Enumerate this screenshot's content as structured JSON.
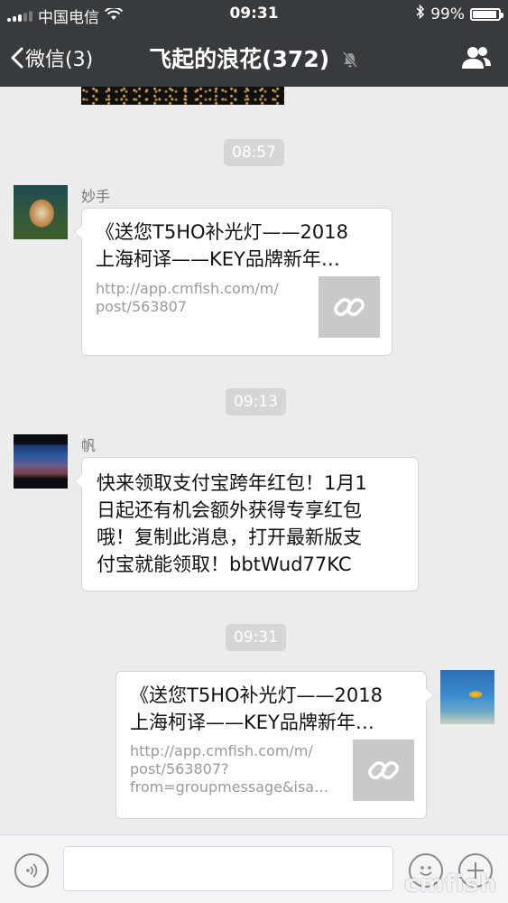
{
  "status_bar": {
    "carrier": "中国电信",
    "time": "09:31",
    "battery_percent": "99%",
    "battery_level": 0.99
  },
  "nav": {
    "back_label": "微信(3)",
    "title": "飞起的浪花(372)",
    "icons": [
      "chevron-left-icon",
      "mute-icon",
      "contacts-icon"
    ]
  },
  "messages": [
    {
      "type": "timestamp",
      "text": "08:57"
    },
    {
      "type": "link",
      "side": "left",
      "sender": "妙手",
      "title_lines": [
        "《送您T5HO补光灯——2018",
        "上海柯译——KEY品牌新年…"
      ],
      "url_lines": [
        "http://app.cmfish.com/m/",
        "post/563807"
      ]
    },
    {
      "type": "timestamp",
      "text": "09:13"
    },
    {
      "type": "text",
      "side": "left",
      "sender": "帆",
      "lines": [
        "快来领取支付宝跨年红包！1月1",
        "日起还有机会额外获得专享红包",
        "哦！复制此消息，打开最新版支",
        "付宝就能领取！bbtWud77KC"
      ]
    },
    {
      "type": "timestamp",
      "text": "09:31"
    },
    {
      "type": "link",
      "side": "right",
      "title_lines": [
        "《送您T5HO补光灯——2018",
        "上海柯译——KEY品牌新年…"
      ],
      "url_lines": [
        "http://app.cmfish.com/m/",
        "post/563807?",
        "from=groupmessage&isa…"
      ]
    }
  ],
  "input_bar": {
    "icons": [
      "voice-icon",
      "emoji-icon",
      "plus-icon"
    ]
  },
  "watermark": "cmfish"
}
